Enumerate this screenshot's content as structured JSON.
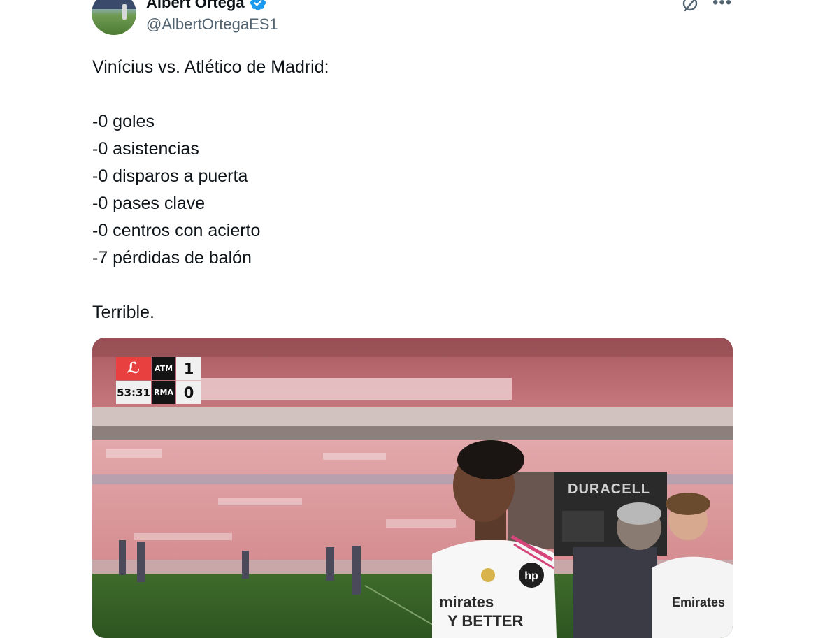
{
  "author": {
    "name": "Albert Ortega",
    "handle": "@AlbertOrtegaES1",
    "verified": true
  },
  "colors": {
    "verified": "#1d9bf0",
    "text": "#0f1419",
    "secondary": "#536471"
  },
  "icons": {
    "verified": "verified-badge-icon",
    "grok": "grok-icon",
    "more": "more-icon"
  },
  "tweet": {
    "text": "Vinícius vs. Atlético de Madrid:\n\n-0 goles\n-0 asistencias\n-0 disparos a puerta\n-0 pases clave\n-0 centros con acierto\n-7 pérdidas de balón\n\nTerrible."
  },
  "media": {
    "scoreboard": {
      "clock": "53:31",
      "home_team": "ATM",
      "away_team": "RMA",
      "home_score": "1",
      "away_score": "0"
    },
    "sponsor_board": "DURACELL",
    "shirt_sponsor": "Emirates FLY BETTER",
    "shirt_sponsor_visible": "mirates",
    "shirt_sponsor_line2": "Y BETTER",
    "shirt_sponsor_right": "Emirates"
  }
}
